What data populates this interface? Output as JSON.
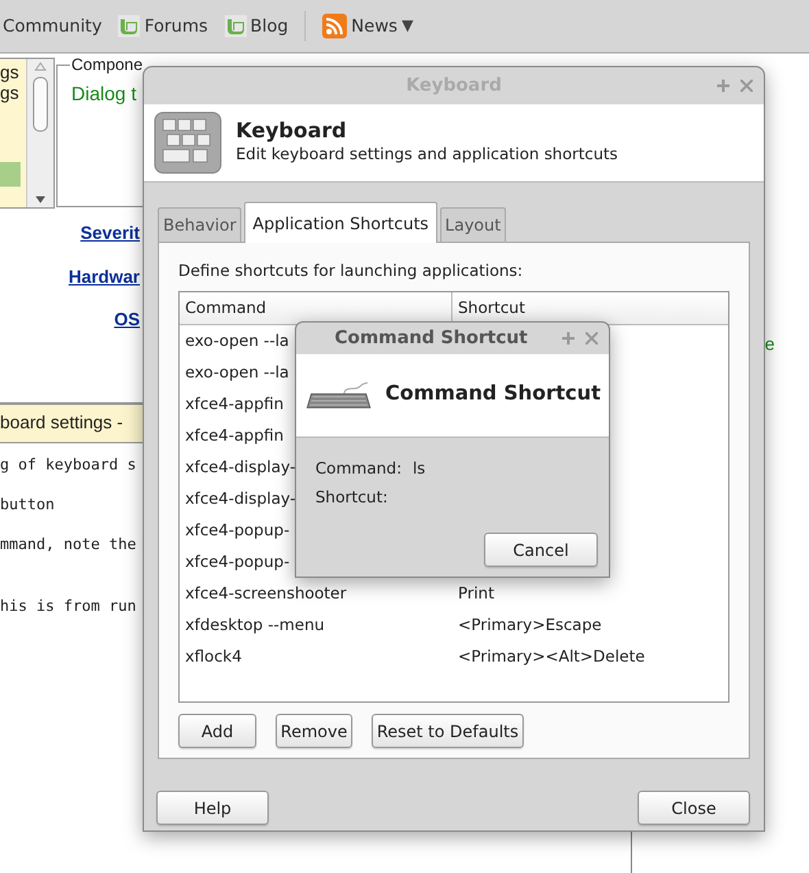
{
  "browser_nav": {
    "items": [
      {
        "label": "Community",
        "kind": "plain"
      },
      {
        "label": "Forums",
        "kind": "mint"
      },
      {
        "label": "Blog",
        "kind": "mint"
      },
      {
        "label": "News",
        "kind": "rss",
        "caret": "▼"
      }
    ]
  },
  "background_page": {
    "list_items": [
      "gs",
      "gs"
    ],
    "fieldset_legend": "Compone",
    "fieldset_text": "Dialog t",
    "fields": [
      "Severit",
      "Hardwar",
      "OS"
    ],
    "bar_text": "board settings -",
    "code_lines": [
      "g of keyboard s",
      "button",
      "mmand, note the",
      "his is from run"
    ],
    "side_text": "e"
  },
  "keyboard_window": {
    "title": "Keyboard",
    "header_title": "Keyboard",
    "header_subtitle": "Edit keyboard settings and application shortcuts",
    "tabs": [
      {
        "label": "Behavior",
        "selected": false
      },
      {
        "label": "Application Shortcuts",
        "selected": true
      },
      {
        "label": "Layout",
        "selected": false
      }
    ],
    "intro": "Define shortcuts for launching applications:",
    "table": {
      "columns": [
        "Command",
        "Shortcut"
      ],
      "rows": [
        {
          "command": "exo-open --la"
        },
        {
          "command": "exo-open --la"
        },
        {
          "command": "xfce4-appfin"
        },
        {
          "command": "xfce4-appfin"
        },
        {
          "command": "xfce4-display-"
        },
        {
          "command": "xfce4-display-"
        },
        {
          "command": "xfce4-popup-"
        },
        {
          "command": "xfce4-popup-"
        },
        {
          "command": "xfce4-screenshooter",
          "shortcut": "Print"
        },
        {
          "command": "xfdesktop --menu",
          "shortcut": "<Primary>Escape"
        },
        {
          "command": "xflock4",
          "shortcut": "<Primary><Alt>Delete"
        }
      ]
    },
    "table_buttons": [
      "Add",
      "Remove",
      "Reset to Defaults"
    ],
    "footer_buttons": [
      "Help",
      "Close"
    ]
  },
  "shortcut_dialog": {
    "title": "Command Shortcut",
    "header_title": "Command Shortcut",
    "fields": [
      {
        "label": "Command:",
        "value": "ls"
      },
      {
        "label": "Shortcut:"
      }
    ],
    "buttons": [
      "Cancel"
    ]
  }
}
